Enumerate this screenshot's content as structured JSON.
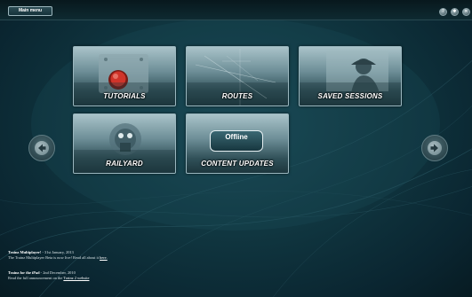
{
  "topbar": {
    "main_menu_label": "Main menu",
    "buttons": [
      {
        "name": "help-button",
        "glyph": "?"
      },
      {
        "name": "settings-button",
        "glyph": "✱"
      },
      {
        "name": "close-button",
        "glyph": "✕"
      }
    ]
  },
  "tiles": {
    "tutorials": "TUTORIALS",
    "routes": "ROUTES",
    "saved_sessions": "SAVED SESSIONS",
    "railyard": "RAILYARD",
    "content_updates": "CONTENT UPDATES",
    "offline_badge": "Offline"
  },
  "nav": {
    "left_icon": "arrow-left-icon",
    "right_icon": "arrow-right-icon"
  },
  "news": [
    {
      "headline": "Trainz Multiplayer!",
      "date": " - 31st January, 2013",
      "body": "The Trainz Multiplayer Beta is now live! Read all about it ",
      "link": "here."
    },
    {
      "headline": "Trainz for the iPad",
      "date": " - 2nd December, 2010",
      "body": "Read the full announcement on the ",
      "link": "Trainz 2 website"
    }
  ],
  "colors": {
    "background": "#103640",
    "tile_border": "#9bb7bf",
    "label": "#ffffff"
  }
}
